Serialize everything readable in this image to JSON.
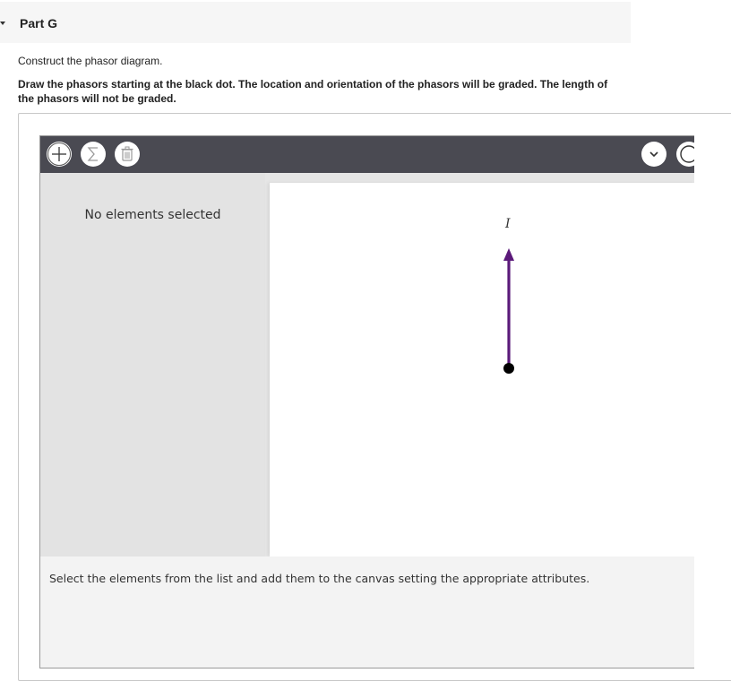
{
  "part": {
    "title": "Part G"
  },
  "instructions": {
    "prompt": "Construct the phasor diagram.",
    "detail": "Draw the phasors starting at the black dot. The location and orientation of the phasors will be graded. The length of the phasors will not be graded."
  },
  "toolbar": {
    "left_icons": [
      "plus-icon",
      "sigma-icon",
      "trash-icon"
    ],
    "right_icons": [
      "chevron-down-icon",
      "circle-icon"
    ]
  },
  "side_panel": {
    "status": "No elements selected"
  },
  "canvas": {
    "phasors": [
      {
        "label": "I",
        "direction": "up",
        "color": "#5b1a7a"
      }
    ],
    "origin_color": "#000000"
  },
  "bottom_panel": {
    "hint": "Select the elements from the list and add them to the canvas setting the appropriate attributes."
  },
  "colors": {
    "toolbar_bg": "#4a4a52",
    "phasor": "#5b1a7a"
  }
}
